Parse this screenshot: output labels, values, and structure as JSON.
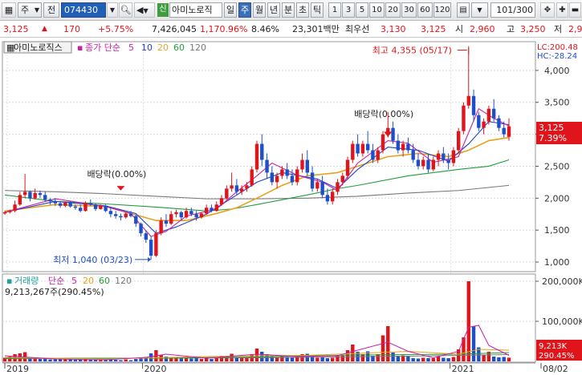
{
  "toolbar": {
    "market_label": "주",
    "prev_label": "전",
    "code_value": "074430",
    "new_badge": "신",
    "stock_name": "아미노로직",
    "periods": [
      "일",
      "주",
      "월",
      "년",
      "분",
      "초",
      "틱"
    ],
    "selected_period": "주",
    "numbers": [
      "1",
      "3",
      "5",
      "10",
      "20",
      "30",
      "60",
      "120"
    ],
    "count_value": "101/300"
  },
  "quote": {
    "price": "3,125",
    "change": "170",
    "change_pct": "+5.75%",
    "volume": "7,426,045",
    "volume_ratio": "1,170.96%",
    "turnover": "8.46%",
    "amount": "23,301백만",
    "best_label": "최우선",
    "ask": "3,130",
    "bid": "3,125",
    "open_label": "시",
    "open": "2,960",
    "high_label": "고",
    "high": "3,250",
    "low_label": "저",
    "low": "2,9"
  },
  "price_panel": {
    "name_tag": "아미노로직스",
    "ma_title": "종가 단순",
    "ma_periods": [
      "5",
      "10",
      "20",
      "60",
      "120"
    ],
    "ma_colors": [
      "#cc1fa8",
      "#1f3fd0",
      "#e8a21a",
      "#1f9e3a",
      "#777777"
    ],
    "lc_label": "LC:200.48",
    "hc_label": "HC:-28.24",
    "current_price": "3,125",
    "current_pct": "7.39%",
    "annotations": {
      "high": "최고 4,355 (05/17)",
      "low": "최저 1,040 (03/23)",
      "div1": "배당락(0.00%)",
      "div2": "배당락(0.00%)"
    }
  },
  "volume_panel": {
    "title": "거래량",
    "ma_title": "단순",
    "ma_periods": [
      "5",
      "20",
      "60",
      "120"
    ],
    "ma_colors": [
      "#cc1fa8",
      "#e8a21a",
      "#1f9e3a",
      "#777777"
    ],
    "info": "9,213,267주(290.45%)",
    "current": "9,213K",
    "current_pct": "290.45%"
  },
  "x_axis": [
    "2019",
    "2020",
    "2021",
    "08/02"
  ],
  "chart_data": [
    {
      "type": "candlestick",
      "title": "",
      "y_ticks": [
        1000,
        1500,
        2000,
        2500,
        3000,
        3500,
        4000
      ],
      "ylim": [
        850,
        4450
      ],
      "y_unit_label": "",
      "candles": [
        [
          1760,
          1800,
          1740,
          1780
        ],
        [
          1780,
          1820,
          1760,
          1800
        ],
        [
          1800,
          1960,
          1780,
          1900
        ],
        [
          1900,
          2100,
          1880,
          2050
        ],
        [
          2050,
          2380,
          2000,
          2100
        ],
        [
          2100,
          2120,
          1950,
          2000
        ],
        [
          2000,
          2150,
          1980,
          2080
        ],
        [
          2080,
          2120,
          2000,
          2050
        ],
        [
          2050,
          2100,
          1950,
          1980
        ],
        [
          1980,
          2000,
          1900,
          1950
        ],
        [
          1950,
          2000,
          1880,
          1920
        ],
        [
          1920,
          1950,
          1850,
          1880
        ],
        [
          1880,
          1950,
          1860,
          1930
        ],
        [
          1930,
          1960,
          1850,
          1870
        ],
        [
          1870,
          1900,
          1820,
          1850
        ],
        [
          1850,
          1900,
          1780,
          1800
        ],
        [
          1800,
          1950,
          1790,
          1920
        ],
        [
          1920,
          1980,
          1880,
          1900
        ],
        [
          1900,
          1920,
          1800,
          1830
        ],
        [
          1830,
          1900,
          1820,
          1880
        ],
        [
          1880,
          1900,
          1780,
          1800
        ],
        [
          1800,
          1850,
          1700,
          1750
        ],
        [
          1750,
          1800,
          1680,
          1720
        ],
        [
          1720,
          1760,
          1650,
          1700
        ],
        [
          1700,
          1780,
          1680,
          1760
        ],
        [
          1760,
          1800,
          1700,
          1720
        ],
        [
          1720,
          1740,
          1550,
          1600
        ],
        [
          1600,
          1620,
          1400,
          1450
        ],
        [
          1450,
          1500,
          1300,
          1350
        ],
        [
          1350,
          1400,
          1040,
          1100
        ],
        [
          1100,
          1500,
          1080,
          1450
        ],
        [
          1450,
          1700,
          1420,
          1650
        ],
        [
          1650,
          1750,
          1550,
          1600
        ],
        [
          1600,
          1800,
          1580,
          1750
        ],
        [
          1750,
          1820,
          1700,
          1780
        ],
        [
          1780,
          1800,
          1650,
          1700
        ],
        [
          1700,
          1850,
          1680,
          1800
        ],
        [
          1800,
          1850,
          1720,
          1750
        ],
        [
          1750,
          1800,
          1650,
          1700
        ],
        [
          1700,
          1780,
          1680,
          1760
        ],
        [
          1760,
          1900,
          1740,
          1850
        ],
        [
          1850,
          1900,
          1780,
          1800
        ],
        [
          1800,
          1950,
          1790,
          1900
        ],
        [
          1900,
          2050,
          1880,
          2000
        ],
        [
          2000,
          2200,
          1980,
          2150
        ],
        [
          2150,
          2400,
          2100,
          2200
        ],
        [
          2200,
          2300,
          2050,
          2100
        ],
        [
          2100,
          2200,
          2050,
          2150
        ],
        [
          2150,
          2250,
          2100,
          2200
        ],
        [
          2200,
          2500,
          2180,
          2450
        ],
        [
          2450,
          2900,
          2400,
          2850
        ],
        [
          2850,
          3000,
          2500,
          2600
        ],
        [
          2600,
          2700,
          2300,
          2400
        ],
        [
          2400,
          2500,
          2200,
          2250
        ],
        [
          2250,
          2400,
          2150,
          2350
        ],
        [
          2350,
          2500,
          2300,
          2450
        ],
        [
          2450,
          2550,
          2300,
          2350
        ],
        [
          2350,
          2450,
          2200,
          2250
        ],
        [
          2250,
          2500,
          2200,
          2450
        ],
        [
          2450,
          2700,
          2400,
          2600
        ],
        [
          2600,
          2750,
          2350,
          2400
        ],
        [
          2400,
          2500,
          2100,
          2150
        ],
        [
          2150,
          2300,
          2100,
          2250
        ],
        [
          2250,
          2350,
          2000,
          2050
        ],
        [
          2050,
          2150,
          1900,
          1950
        ],
        [
          1950,
          2150,
          1900,
          2100
        ],
        [
          2100,
          2300,
          2050,
          2250
        ],
        [
          2250,
          2400,
          2200,
          2350
        ],
        [
          2350,
          2650,
          2300,
          2600
        ],
        [
          2600,
          2900,
          2550,
          2850
        ],
        [
          2850,
          3000,
          2650,
          2700
        ],
        [
          2700,
          2900,
          2650,
          2850
        ],
        [
          2850,
          3050,
          2700,
          2750
        ],
        [
          2750,
          2850,
          2550,
          2600
        ],
        [
          2600,
          2800,
          2550,
          2750
        ],
        [
          2750,
          3050,
          2700,
          3000
        ],
        [
          3000,
          3350,
          2950,
          3100
        ],
        [
          3100,
          3200,
          2850,
          2900
        ],
        [
          2900,
          3000,
          2700,
          2750
        ],
        [
          2750,
          2900,
          2650,
          2850
        ],
        [
          2850,
          2950,
          2700,
          2750
        ],
        [
          2750,
          2850,
          2550,
          2600
        ],
        [
          2600,
          2700,
          2450,
          2500
        ],
        [
          2500,
          2650,
          2450,
          2600
        ],
        [
          2600,
          2700,
          2400,
          2450
        ],
        [
          2450,
          2650,
          2420,
          2600
        ],
        [
          2600,
          2750,
          2500,
          2700
        ],
        [
          2700,
          2800,
          2550,
          2600
        ],
        [
          2600,
          2700,
          2450,
          2550
        ],
        [
          2550,
          2800,
          2500,
          2750
        ],
        [
          2750,
          3100,
          2700,
          3050
        ],
        [
          3050,
          3500,
          3000,
          3450
        ],
        [
          3450,
          4355,
          3400,
          3600
        ],
        [
          3600,
          3700,
          3200,
          3300
        ],
        [
          3300,
          3350,
          3050,
          3100
        ],
        [
          3100,
          3250,
          3000,
          3200
        ],
        [
          3200,
          3450,
          3150,
          3400
        ],
        [
          3400,
          3550,
          3200,
          3250
        ],
        [
          3250,
          3300,
          3050,
          3100
        ],
        [
          3100,
          3200,
          2950,
          3000
        ],
        [
          2960,
          3250,
          2900,
          3125
        ]
      ],
      "ma": {
        "5": [
          [
            0,
            1780
          ],
          [
            10,
            1990
          ],
          [
            20,
            1870
          ],
          [
            25,
            1760
          ],
          [
            29,
            1400
          ],
          [
            32,
            1480
          ],
          [
            36,
            1720
          ],
          [
            42,
            1830
          ],
          [
            46,
            2100
          ],
          [
            50,
            2350
          ],
          [
            53,
            2550
          ],
          [
            58,
            2360
          ],
          [
            63,
            2250
          ],
          [
            66,
            2120
          ],
          [
            70,
            2550
          ],
          [
            76,
            2900
          ],
          [
            80,
            2860
          ],
          [
            85,
            2560
          ],
          [
            90,
            2650
          ],
          [
            94,
            3400
          ],
          [
            97,
            3250
          ],
          [
            100,
            3130
          ]
        ],
        "10": [
          [
            0,
            1780
          ],
          [
            10,
            1950
          ],
          [
            20,
            1880
          ],
          [
            26,
            1760
          ],
          [
            30,
            1450
          ],
          [
            34,
            1550
          ],
          [
            40,
            1750
          ],
          [
            45,
            2000
          ],
          [
            50,
            2250
          ],
          [
            55,
            2400
          ],
          [
            62,
            2300
          ],
          [
            66,
            2150
          ],
          [
            70,
            2450
          ],
          [
            76,
            2800
          ],
          [
            82,
            2750
          ],
          [
            88,
            2580
          ],
          [
            92,
            2850
          ],
          [
            96,
            3200
          ],
          [
            100,
            3150
          ]
        ],
        "20": [
          [
            0,
            1800
          ],
          [
            10,
            1900
          ],
          [
            20,
            1870
          ],
          [
            30,
            1650
          ],
          [
            36,
            1650
          ],
          [
            42,
            1760
          ],
          [
            46,
            1850
          ],
          [
            50,
            2000
          ],
          [
            55,
            2200
          ],
          [
            60,
            2350
          ],
          [
            66,
            2400
          ],
          [
            70,
            2500
          ],
          [
            76,
            2650
          ],
          [
            82,
            2700
          ],
          [
            88,
            2650
          ],
          [
            92,
            2750
          ],
          [
            96,
            2900
          ],
          [
            100,
            2950
          ]
        ],
        "60": [
          [
            0,
            2050
          ],
          [
            10,
            1950
          ],
          [
            20,
            1910
          ],
          [
            30,
            1860
          ],
          [
            40,
            1800
          ],
          [
            45,
            1830
          ],
          [
            50,
            1900
          ],
          [
            60,
            2050
          ],
          [
            66,
            2150
          ],
          [
            70,
            2200
          ],
          [
            80,
            2350
          ],
          [
            90,
            2450
          ],
          [
            96,
            2500
          ],
          [
            100,
            2600
          ]
        ],
        "120": [
          [
            0,
            2120
          ],
          [
            10,
            2100
          ],
          [
            20,
            2070
          ],
          [
            30,
            2030
          ],
          [
            40,
            1990
          ],
          [
            50,
            1990
          ],
          [
            60,
            2000
          ],
          [
            70,
            2030
          ],
          [
            80,
            2080
          ],
          [
            90,
            2120
          ],
          [
            100,
            2200
          ]
        ]
      }
    },
    {
      "type": "bar",
      "title": "",
      "y_ticks_label": [
        "100,000K",
        "200,000K"
      ],
      "y_ticks": [
        100000,
        200000
      ],
      "ylim": [
        0,
        210000
      ],
      "values": [
        9000,
        12000,
        18000,
        20000,
        23000,
        9000,
        8000,
        6000,
        7000,
        5000,
        6000,
        5000,
        5000,
        6000,
        4000,
        5000,
        9000,
        5000,
        4000,
        3000,
        4000,
        4000,
        4000,
        3000,
        5000,
        3000,
        6000,
        9000,
        11000,
        20000,
        28000,
        16000,
        12000,
        10000,
        11000,
        9000,
        8000,
        7000,
        8000,
        6000,
        8000,
        6000,
        9000,
        14000,
        12000,
        19000,
        11000,
        10000,
        9000,
        18000,
        32000,
        24000,
        18000,
        13000,
        10000,
        14000,
        11000,
        9000,
        12000,
        18000,
        19000,
        13000,
        9000,
        11000,
        8000,
        9000,
        15000,
        14000,
        28000,
        42000,
        24000,
        18000,
        25000,
        14000,
        18000,
        65000,
        88000,
        22000,
        14000,
        15000,
        12000,
        8000,
        7000,
        9000,
        8000,
        8000,
        12000,
        9000,
        8000,
        11000,
        30000,
        60000,
        200000,
        88000,
        35000,
        17000,
        24000,
        12000,
        10000,
        11000,
        9213
      ],
      "ma": {
        "5": [
          [
            0,
            14000
          ],
          [
            10,
            6000
          ],
          [
            20,
            4000
          ],
          [
            28,
            10000
          ],
          [
            32,
            18000
          ],
          [
            40,
            8000
          ],
          [
            50,
            18000
          ],
          [
            58,
            12000
          ],
          [
            66,
            14000
          ],
          [
            70,
            28000
          ],
          [
            76,
            48000
          ],
          [
            80,
            25000
          ],
          [
            85,
            9000
          ],
          [
            90,
            25000
          ],
          [
            92,
            85000
          ],
          [
            94,
            90000
          ],
          [
            96,
            40000
          ],
          [
            100,
            15000
          ]
        ],
        "20": [
          [
            0,
            10000
          ],
          [
            20,
            6000
          ],
          [
            30,
            9000
          ],
          [
            40,
            12000
          ],
          [
            50,
            14000
          ],
          [
            60,
            15000
          ],
          [
            70,
            20000
          ],
          [
            80,
            25000
          ],
          [
            90,
            18000
          ],
          [
            94,
            30000
          ],
          [
            100,
            28000
          ]
        ],
        "60": [
          [
            0,
            8000
          ],
          [
            30,
            8000
          ],
          [
            50,
            11000
          ],
          [
            70,
            16000
          ],
          [
            90,
            18000
          ],
          [
            100,
            22000
          ]
        ],
        "120": [
          [
            0,
            7000
          ],
          [
            50,
            9000
          ],
          [
            80,
            13000
          ],
          [
            100,
            17000
          ]
        ]
      }
    }
  ]
}
